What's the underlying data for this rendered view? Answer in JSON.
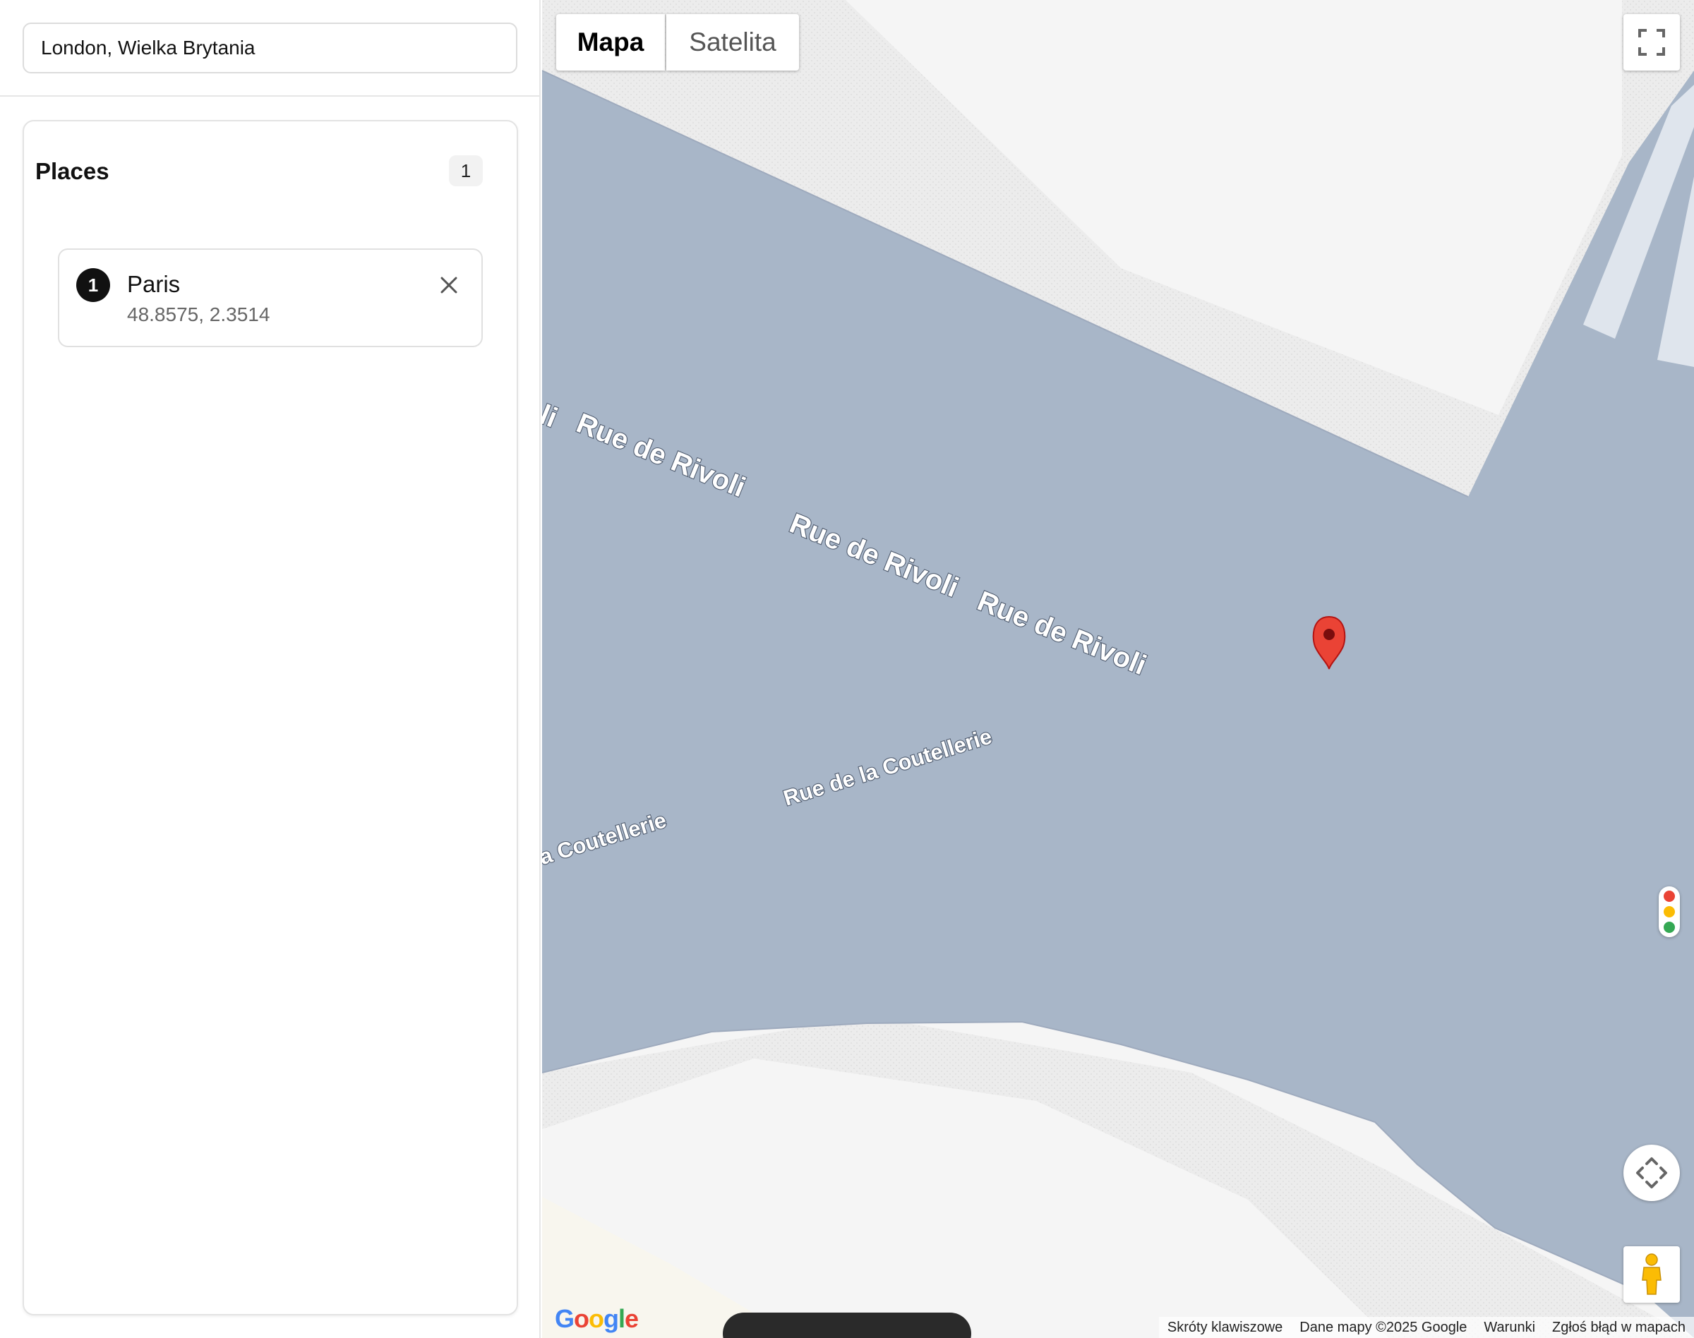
{
  "search": {
    "value": "London, Wielka Brytania"
  },
  "places": {
    "title": "Places",
    "count": "1",
    "items": [
      {
        "number": "1",
        "name": "Paris",
        "coords": "48.8575, 2.3514"
      }
    ]
  },
  "map": {
    "type_buttons": {
      "map": "Mapa",
      "satellite": "Satelita"
    },
    "active_type": "Mapa",
    "street_labels": {
      "rivoli_1": "li",
      "rivoli_2": "Rue de Rivoli",
      "rivoli_3": "Rue de Rivoli",
      "rivoli_4": "Rue de Rivoli",
      "coutellerie_1": "Rue de la Coutellerie",
      "coutellerie_2": "la Coutellerie"
    },
    "logo": "Google",
    "attribution": {
      "shortcuts": "Skróty klawiszowe",
      "data": "Dane mapy ©2025 Google",
      "terms": "Warunki",
      "report": "Zgłoś błąd w mapach"
    },
    "colors": {
      "road": "#a8b6c8",
      "land": "#f5f5f5",
      "marker": "#ea4335"
    },
    "icons": [
      "fullscreen-icon",
      "pan-control-icon",
      "pegman-icon",
      "traffic-light-icon",
      "map-pin-icon",
      "close-icon"
    ]
  }
}
